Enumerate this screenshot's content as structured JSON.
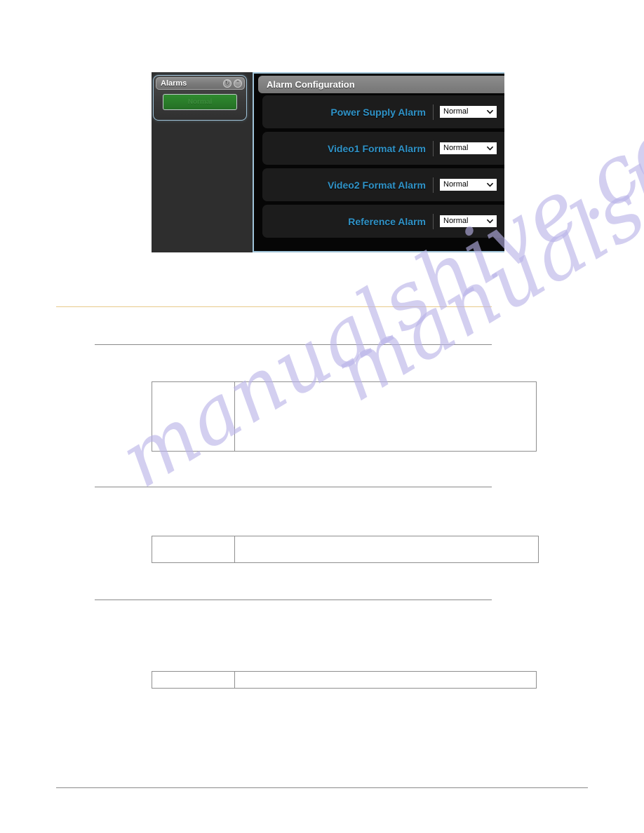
{
  "screenshot": {
    "alarms_widget": {
      "title": "Alarms",
      "icons": [
        {
          "name": "refresh-icon",
          "glyph": "↻"
        },
        {
          "name": "collapse-icon",
          "glyph": "⌃"
        }
      ],
      "status_button_label": "Normal",
      "status_button_color": "#2a7d2a",
      "border_color": "#9fc3d8"
    },
    "config_panel": {
      "header_title": "Alarm Configuration",
      "header_color": "#828282",
      "background_color": "#060606",
      "label_color": "#2f93c8",
      "rows": [
        {
          "label": "Power Supply Alarm",
          "value": "Normal"
        },
        {
          "label": "Video1 Format Alarm",
          "value": "Normal"
        },
        {
          "label": "Video2 Format Alarm",
          "value": "Normal"
        },
        {
          "label": "Reference Alarm",
          "value": "Normal"
        }
      ],
      "select_options": [
        "Normal"
      ]
    }
  },
  "watermark": {
    "line1": "manualshive.com",
    "line2": "manualshive.com",
    "color": "#b9b3e8"
  },
  "document": {
    "rules": [
      {
        "name": "accent-rule",
        "color": "#e8c98a"
      },
      {
        "name": "section-rule-1",
        "color": "#8a8a8a"
      },
      {
        "name": "section-rule-2",
        "color": "#8a8a8a"
      },
      {
        "name": "section-rule-3",
        "color": "#8a8a8a"
      },
      {
        "name": "footer-rule",
        "color": "#8a8a8a"
      }
    ],
    "tables": [
      {
        "name": "parameter-table-1",
        "rows": 1,
        "columns": 2
      },
      {
        "name": "parameter-table-2",
        "rows": 1,
        "columns": 2
      },
      {
        "name": "parameter-table-3",
        "rows": 1,
        "columns": 2
      }
    ]
  }
}
